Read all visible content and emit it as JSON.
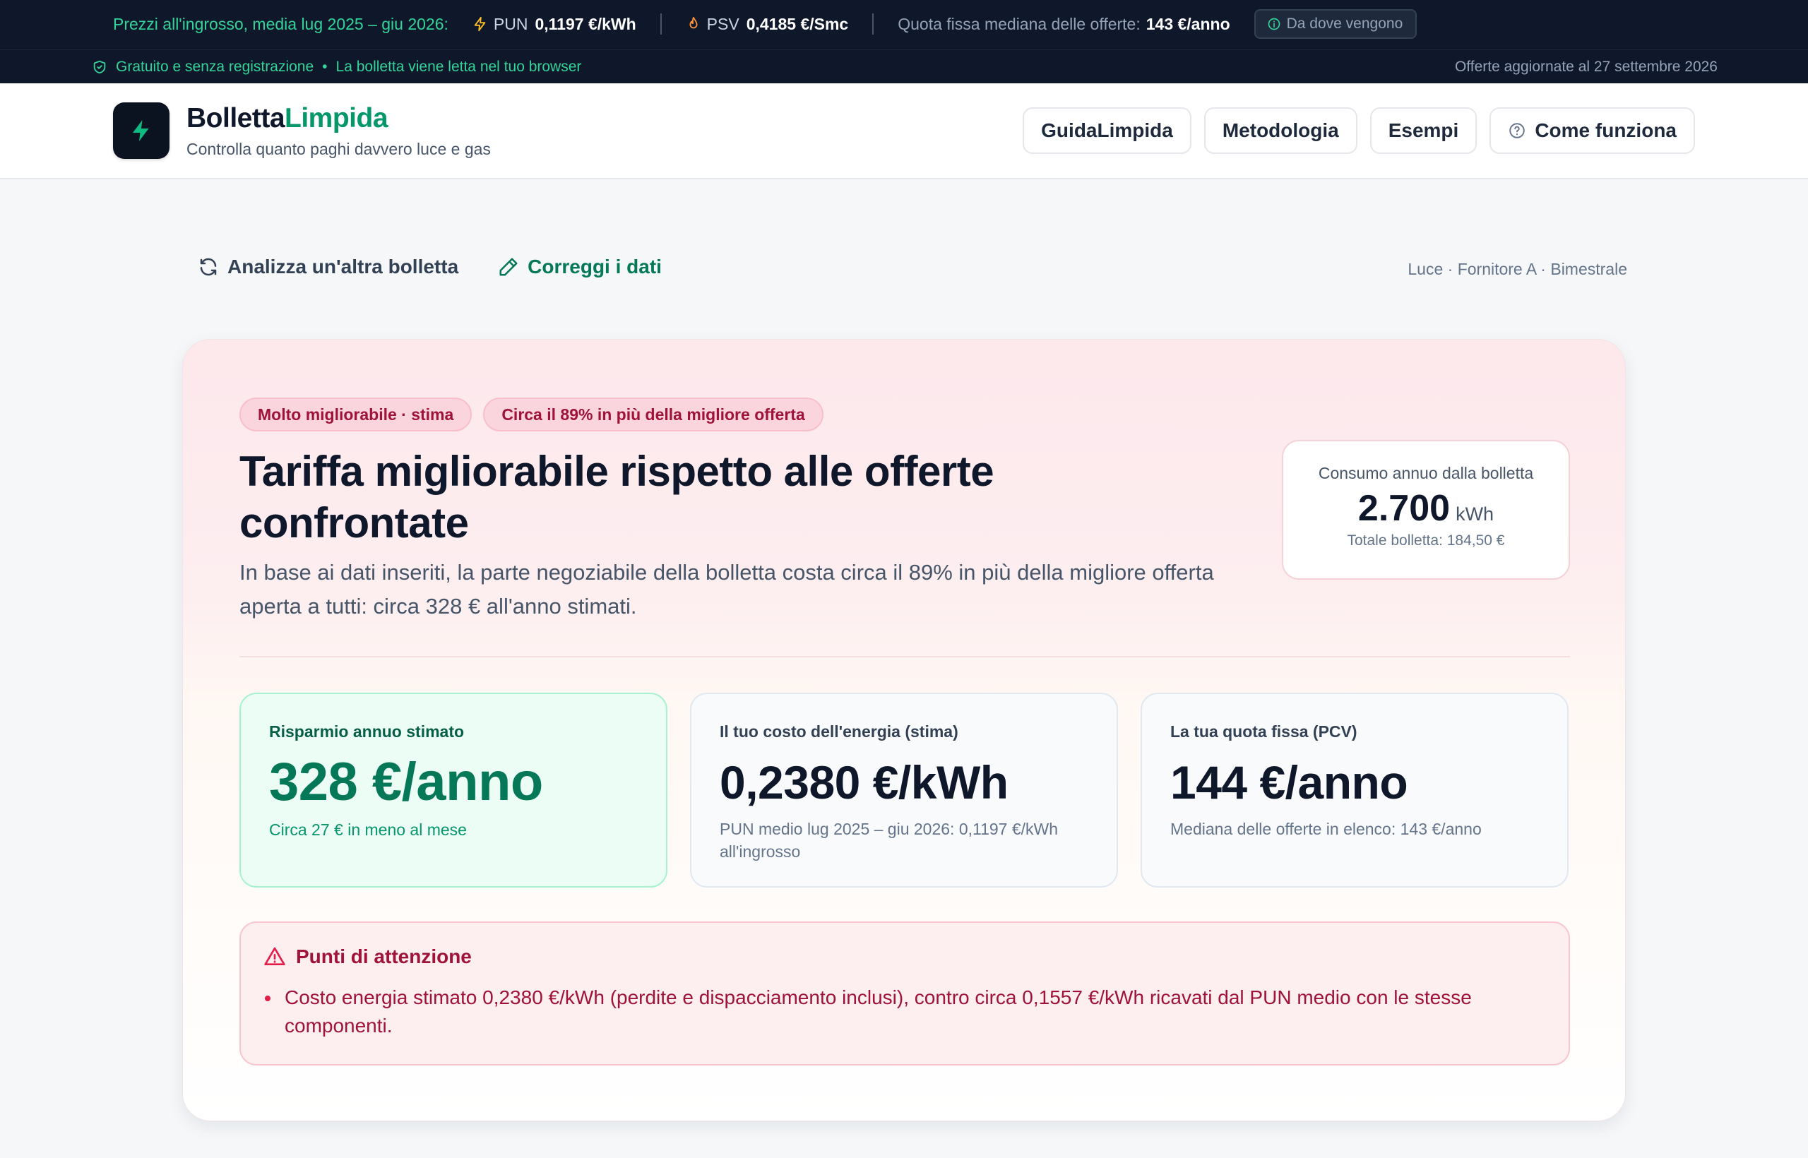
{
  "topbar": {
    "wholesale_lead": "Prezzi all'ingrosso, media lug 2025 – giu 2026:",
    "pun_label": "PUN",
    "pun_value": "0,1197 €/kWh",
    "psv_label": "PSV",
    "psv_value": "0,4185 €/Smc",
    "fixed_fee_label": "Quota fissa mediana delle offerte:",
    "fixed_fee_value": "143 €/anno",
    "source_button": "Da dove vengono",
    "trust_1": "Gratuito e senza registrazione",
    "trust_sep": "•",
    "trust_2": "La bolletta viene letta nel tuo browser",
    "updated": "Offerte aggiornate al 27 settembre 2026"
  },
  "header": {
    "brand_part1": "Bolletta",
    "brand_part2": "Limpida",
    "tagline": "Controlla quanto paghi davvero luce e gas",
    "nav": [
      "GuidaLimpida",
      "Metodologia",
      "Esempi",
      "Come funziona"
    ]
  },
  "actions": {
    "analyze_other": "Analizza un'altra bolletta",
    "correct_data": "Correggi i dati",
    "meta": "Luce · Fornitore A · Bimestrale"
  },
  "result": {
    "chip_rating": "Molto migliorabile · stima",
    "chip_delta": "Circa il 89% in più della migliore offerta",
    "title": "Tariffa migliorabile rispetto alle offerte confrontate",
    "description": "In base ai dati inseriti, la parte negoziabile della bolletta costa circa il 89% in più della migliore offerta aperta a tutti: circa 328 € all'anno stimati.",
    "consumption": {
      "label": "Consumo annuo dalla bolletta",
      "value": "2.700",
      "unit": "kWh",
      "total": "Totale bolletta: 184,50 €"
    },
    "stats": [
      {
        "label": "Risparmio annuo stimato",
        "value": "328 €/anno",
        "sub": "Circa 27 € in meno al mese"
      },
      {
        "label": "Il tuo costo dell'energia (stima)",
        "value": "0,2380 €/kWh",
        "sub": "PUN medio lug 2025 – giu 2026: 0,1197 €/kWh all'ingrosso"
      },
      {
        "label": "La tua quota fissa (PCV)",
        "value": "144 €/anno",
        "sub": "Mediana delle offerte in elenco: 143 €/anno"
      }
    ],
    "attention": {
      "title": "Punti di attenzione",
      "items": [
        "Costo energia stimato 0,2380 €/kWh (perdite e dispacciamento inclusi), contro circa 0,1557 €/kWh ricavati dal PUN medio con le stesse componenti."
      ]
    }
  },
  "colors": {
    "accent_green": "#059669",
    "dark_bar": "#0f172a",
    "warning_red": "#9f1239"
  },
  "icons": [
    "bolt-icon",
    "flame-icon",
    "info-icon",
    "shield-check-icon",
    "refresh-icon",
    "pencil-icon",
    "help-circle-icon",
    "warning-triangle-icon"
  ]
}
